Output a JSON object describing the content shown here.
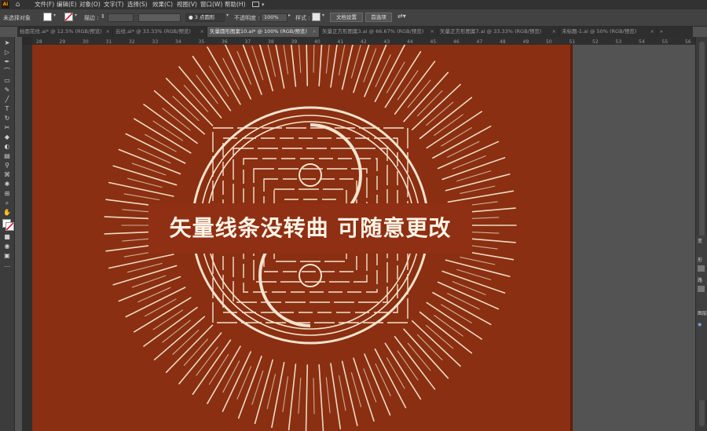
{
  "menu": {
    "app_logo": "Ai",
    "items": [
      "文件(F)",
      "编辑(E)",
      "对象(O)",
      "文字(T)",
      "选择(S)",
      "效果(C)",
      "视图(V)",
      "窗口(W)",
      "帮助(H)"
    ]
  },
  "control": {
    "selection_label": "未选择对象",
    "stroke_label": "描边 :",
    "brush_label": "3 点圆形",
    "opacity_label": "不透明度 :",
    "opacity_value": "100%",
    "style_label": "样式 :",
    "doc_setup_button": "文档设置",
    "preferences_button": "首选项"
  },
  "tabs": [
    "拍面花纹.ai* @ 12.5% (RGB/预览)",
    "云纹.ai* @ 33.33% (RGB/预览)",
    "矢量圆形图案10.ai* @ 100% (RGB/预览)",
    "矢量正方形图案3.ai @ 66.67% (RGB/预览)",
    "矢量正方形图案7.ai @ 33.33% (RGB/预览)",
    "未标题-1.ai @ 50% (RGB/预览)"
  ],
  "ruler_ticks": [
    "28",
    "29",
    "30",
    "31",
    "32",
    "33",
    "34",
    "35",
    "36",
    "37",
    "38",
    "39",
    "40",
    "41",
    "42",
    "43",
    "44",
    "45",
    "46",
    "47",
    "48",
    "49",
    "50",
    "51",
    "52",
    "53",
    "54",
    "55",
    "56"
  ],
  "artwork": {
    "headline": "矢量线条没转曲  可随意更改",
    "colors": {
      "background": "#8a2f12",
      "line": "#f4e3cc",
      "banner": "#8f2f14"
    }
  },
  "side_panel": {
    "labels": [
      "变",
      "形",
      "路",
      "图层"
    ]
  },
  "icons": [
    "home-icon",
    "workspace-grid-icon",
    "selection-tool-icon",
    "direct-selection-tool-icon",
    "pen-tool-icon",
    "type-tool-icon",
    "rectangle-tool-icon",
    "eye-icon"
  ]
}
